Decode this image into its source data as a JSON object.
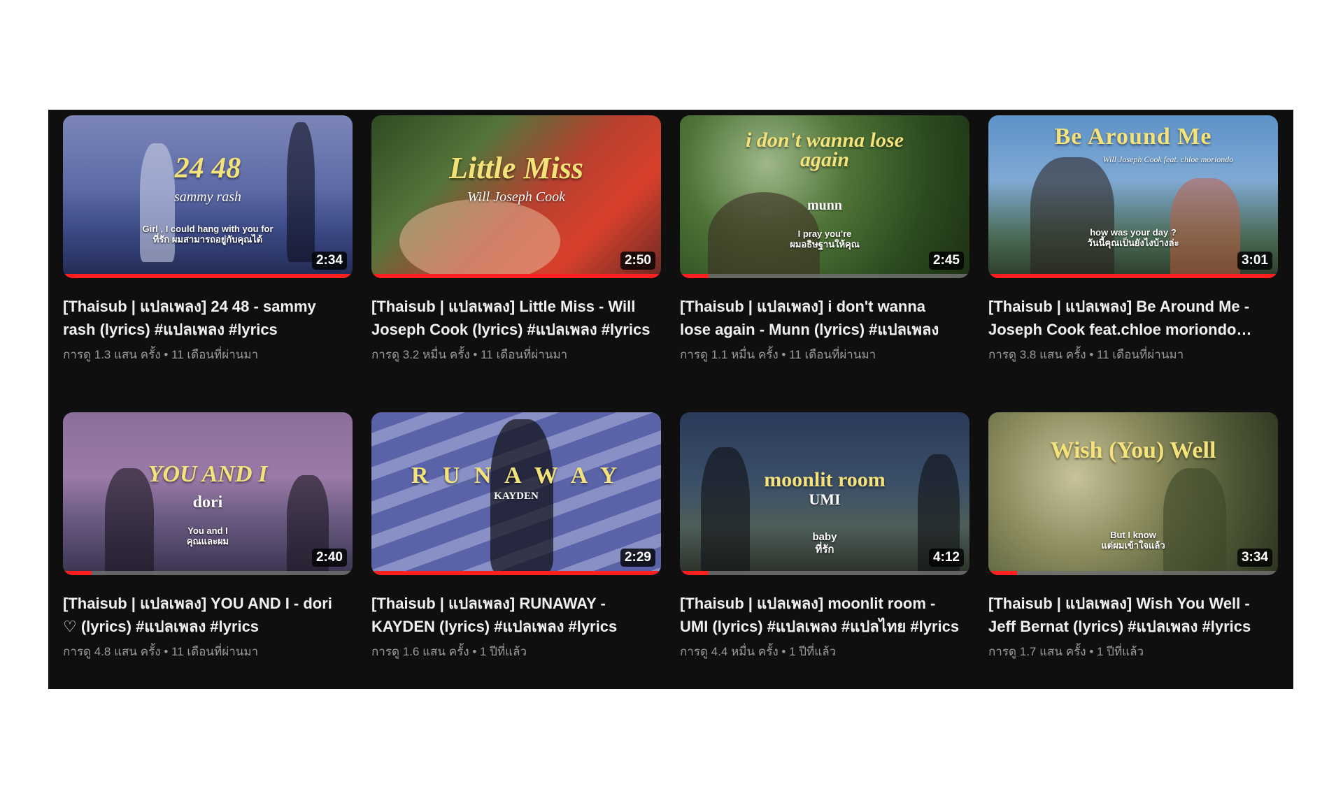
{
  "videos": [
    {
      "duration": "2:34",
      "progress": 1.0,
      "overlay": {
        "title": "24 48",
        "artist": "sammy rash",
        "lyric1": "Girl , I could hang with you for",
        "lyric2": "ที่รัก ผมสามารถอยู่กับคุณได้"
      },
      "title": "[Thaisub | แปลเพลง] 24 48 - sammy rash (lyrics) #แปลเพลง #lyrics",
      "views": "การดู 1.3 แสน ครั้ง",
      "age": "11 เดือนที่ผ่านมา"
    },
    {
      "duration": "2:50",
      "progress": 1.0,
      "overlay": {
        "title": "Little Miss",
        "artist": "Will Joseph Cook",
        "lyric1": "",
        "lyric2": ""
      },
      "title": "[Thaisub | แปลเพลง] Little Miss - Will Joseph Cook (lyrics) #แปลเพลง #lyrics",
      "views": "การดู 3.2 หมื่น ครั้ง",
      "age": "11 เดือนที่ผ่านมา"
    },
    {
      "duration": "2:45",
      "progress": 0.1,
      "overlay": {
        "title": "i don't wanna lose again",
        "artist": "munn",
        "lyric1": "I pray you're",
        "lyric2": "ผมอธิษฐานให้คุณ"
      },
      "title": "[Thaisub | แปลเพลง] i don't wanna lose again - Munn (lyrics) #แปลเพลง",
      "views": "การดู 1.1 หมื่น ครั้ง",
      "age": "11 เดือนที่ผ่านมา"
    },
    {
      "duration": "3:01",
      "progress": 1.0,
      "overlay": {
        "title": "Be Around Me",
        "artist": "Will Joseph Cook feat. chloe moriondo",
        "lyric1": "how was your day ?",
        "lyric2": "วันนี้คุณเป็นยังไงบ้างล่ะ"
      },
      "title": "[Thaisub | แปลเพลง] Be Around Me - Joseph Cook feat.chloe moriondo (lyrics)",
      "views": "การดู 3.8 แสน ครั้ง",
      "age": "11 เดือนที่ผ่านมา"
    },
    {
      "duration": "2:40",
      "progress": 0.1,
      "overlay": {
        "title": "YOU AND I",
        "artist": "dori",
        "lyric1": "You and I",
        "lyric2": "คุณและผม"
      },
      "title": "[Thaisub | แปลเพลง] YOU AND I - dori ♡ (lyrics) #แปลเพลง #lyrics",
      "views": "การดู 4.8 แสน ครั้ง",
      "age": "11 เดือนที่ผ่านมา"
    },
    {
      "duration": "2:29",
      "progress": 1.0,
      "overlay": {
        "title": "R U N A W A Y",
        "artist": "KAYDEN",
        "lyric1": "",
        "lyric2": ""
      },
      "title": "[Thaisub | แปลเพลง] RUNAWAY - KAYDEN (lyrics) #แปลเพลง #lyrics",
      "views": "การดู 1.6 แสน ครั้ง",
      "age": "1 ปีที่แล้ว"
    },
    {
      "duration": "4:12",
      "progress": 0.1,
      "overlay": {
        "title": "moonlit room",
        "artist": "UMI",
        "lyric1": "baby",
        "lyric2": "ที่รัก"
      },
      "title": "[Thaisub | แปลเพลง] moonlit room - UMI (lyrics) #แปลเพลง #แปลไทย #lyrics",
      "views": "การดู 4.4 หมื่น ครั้ง",
      "age": "1 ปีที่แล้ว"
    },
    {
      "duration": "3:34",
      "progress": 0.1,
      "overlay": {
        "title": "Wish (You) Well",
        "artist": "",
        "lyric1": "But I know",
        "lyric2": "แต่ผมเข้าใจแล้ว"
      },
      "title": "[Thaisub | แปลเพลง] Wish You Well - Jeff Bernat (lyrics) #แปลเพลง #lyrics",
      "views": "การดู 1.7 แสน ครั้ง",
      "age": "1 ปีที่แล้ว"
    }
  ],
  "separator": "•",
  "colors": {
    "progress": "#ff1f1f",
    "panel": "#0f0f10",
    "overlay_text": "#f4e27a"
  }
}
